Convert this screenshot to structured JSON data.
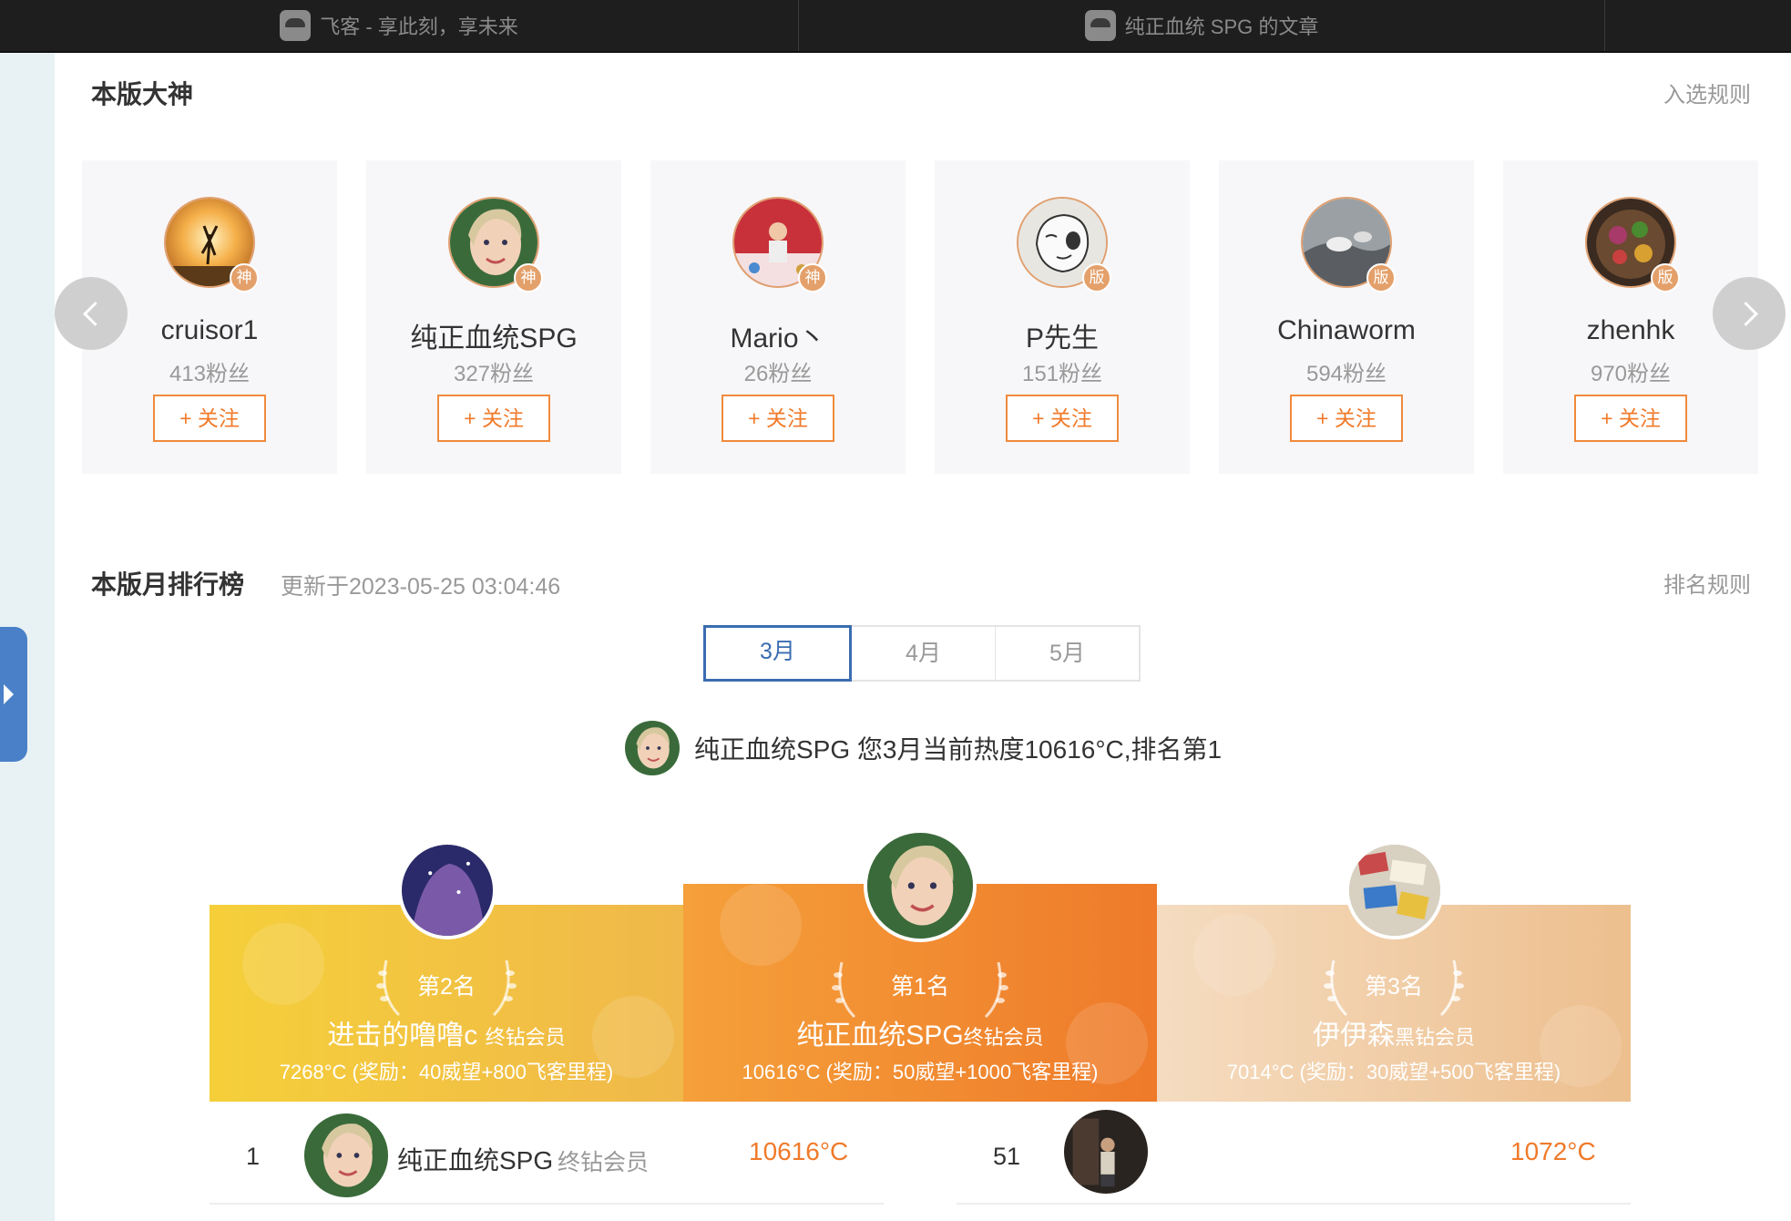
{
  "tabs": [
    {
      "label": "飞客 - 享此刻，享未来",
      "icon": "app-icon"
    },
    {
      "label": "纯正血统 SPG 的文章",
      "icon": "app-icon"
    }
  ],
  "gods": {
    "title": "本版大神",
    "rules_link": "入选规则",
    "cards": [
      {
        "name": "cruisor1",
        "fans": "413粉丝",
        "badge": "神",
        "follow": "+ 关注"
      },
      {
        "name": "纯正血统SPG",
        "fans": "327粉丝",
        "badge": "神",
        "follow": "+ 关注"
      },
      {
        "name": "Mario丶",
        "fans": "26粉丝",
        "badge": "神",
        "follow": "+ 关注"
      },
      {
        "name": "P先生",
        "fans": "151粉丝",
        "badge": "版",
        "follow": "+ 关注"
      },
      {
        "name": "Chinaworm",
        "fans": "594粉丝",
        "badge": "版",
        "follow": "+ 关注"
      },
      {
        "name": "zhenhk",
        "fans": "970粉丝",
        "badge": "版",
        "follow": "+ 关注"
      }
    ]
  },
  "ranking": {
    "title": "本版月排行榜",
    "updated": "更新于2023-05-25 03:04:46",
    "rules_link": "排名规则",
    "months": [
      "3月",
      "4月",
      "5月"
    ],
    "active_month": "3月",
    "my_status": "纯正血统SPG 您3月当前热度10616°C,排名第1",
    "podium": {
      "second": {
        "rank": "第2名",
        "name": "进击的噜噜c",
        "level": "终钻会员",
        "heat": "7268°C",
        "reward": "(奖励：40威望+800飞客里程)"
      },
      "first": {
        "rank": "第1名",
        "name": "纯正血统SPG",
        "level": "终钻会员",
        "heat": "10616°C",
        "reward": "(奖励：50威望+1000飞客里程)"
      },
      "third": {
        "rank": "第3名",
        "name": "伊伊森",
        "level": "黑钻会员",
        "heat": "7014°C",
        "reward": "(奖励：30威望+500飞客里程)"
      }
    },
    "rows": [
      {
        "num": "1",
        "name": "纯正血统SPG",
        "level": "终钻会员",
        "heat": "10616°C"
      },
      {
        "num": "51",
        "name": "",
        "level": "",
        "heat": "1072°C"
      }
    ]
  },
  "colors": {
    "accent": "#f07a2a",
    "tab_active": "#3a6db0",
    "gold": "#f2c232",
    "orange": "#f08030",
    "peach": "#f0c9a0"
  }
}
